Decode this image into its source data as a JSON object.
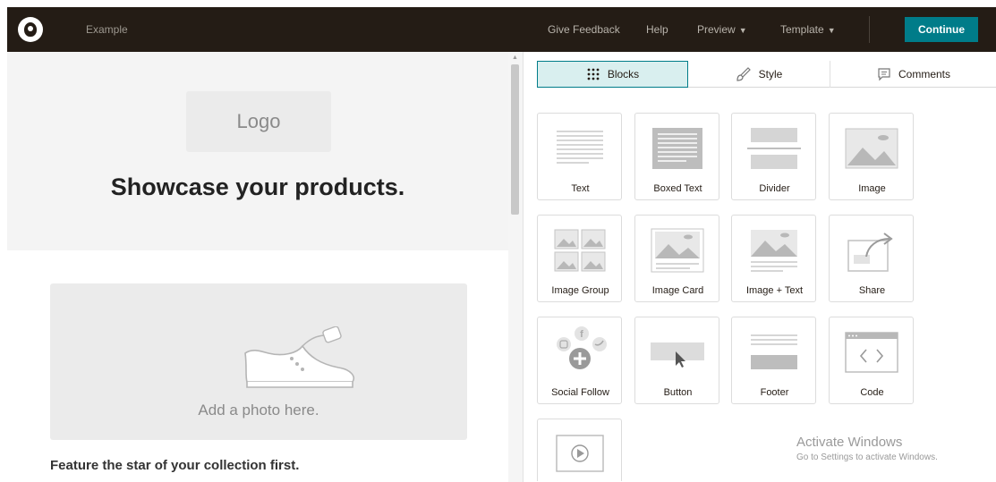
{
  "topbar": {
    "campaign_name": "Example",
    "nav": {
      "give_feedback": "Give Feedback",
      "help": "Help",
      "preview": "Preview",
      "template": "Template"
    },
    "continue_label": "Continue",
    "accent_color": "#007c89",
    "bar_color": "#241c15"
  },
  "preview": {
    "logo_placeholder": "Logo",
    "hero_title": "Showcase your products.",
    "photo_placeholder": "Add a photo here.",
    "feature_text": "Feature the star of your collection first."
  },
  "panel": {
    "tabs": [
      {
        "label": "Blocks",
        "icon": "blocks-grid-icon",
        "active": true
      },
      {
        "label": "Style",
        "icon": "style-brush-icon",
        "active": false
      },
      {
        "label": "Comments",
        "icon": "comment-icon",
        "active": false
      }
    ],
    "blocks": [
      {
        "label": "Text",
        "icon": "text-block-icon"
      },
      {
        "label": "Boxed Text",
        "icon": "boxed-text-icon"
      },
      {
        "label": "Divider",
        "icon": "divider-icon"
      },
      {
        "label": "Image",
        "icon": "image-icon"
      },
      {
        "label": "Image Group",
        "icon": "image-group-icon"
      },
      {
        "label": "Image Card",
        "icon": "image-card-icon"
      },
      {
        "label": "Image + Text",
        "icon": "image-text-icon"
      },
      {
        "label": "Share",
        "icon": "share-icon"
      },
      {
        "label": "Social Follow",
        "icon": "social-follow-icon"
      },
      {
        "label": "Button",
        "icon": "button-block-icon"
      },
      {
        "label": "Footer",
        "icon": "footer-icon"
      },
      {
        "label": "Code",
        "icon": "code-icon"
      },
      {
        "label": "",
        "icon": "video-icon"
      }
    ]
  },
  "watermark": {
    "title": "Activate Windows",
    "subtitle": "Go to Settings to activate Windows."
  }
}
